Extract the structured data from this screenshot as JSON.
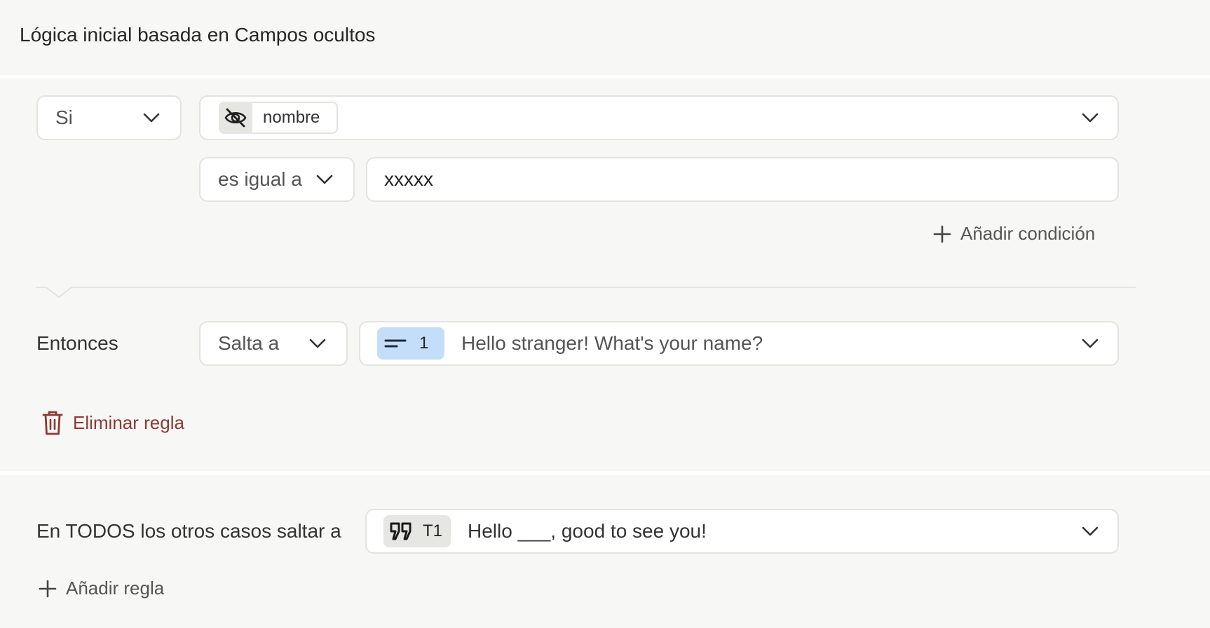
{
  "header": {
    "title": "Lógica inicial basada en Campos ocultos"
  },
  "rule": {
    "if_label": "Si",
    "field_chip": {
      "icon": "eye-off-icon",
      "label": "nombre"
    },
    "operator_label": "es igual a",
    "value_text": "xxxxx",
    "add_condition_label": "Añadir condición",
    "then_label": "Entonces",
    "action_label": "Salta a",
    "target": {
      "icon": "short-text-icon",
      "number": "1",
      "text": "Hello stranger! What's your name?",
      "chip_color": "#c4defa"
    },
    "delete_rule_label": "Eliminar regla",
    "delete_color": "#8a3a35"
  },
  "fallback": {
    "label": "En TODOS los otros casos saltar a",
    "target": {
      "icon": "quote-icon",
      "number": "T1",
      "text": "Hello ___, good to see you!",
      "chip_color": "#e6e6e3"
    },
    "add_rule_label": "Añadir regla"
  }
}
